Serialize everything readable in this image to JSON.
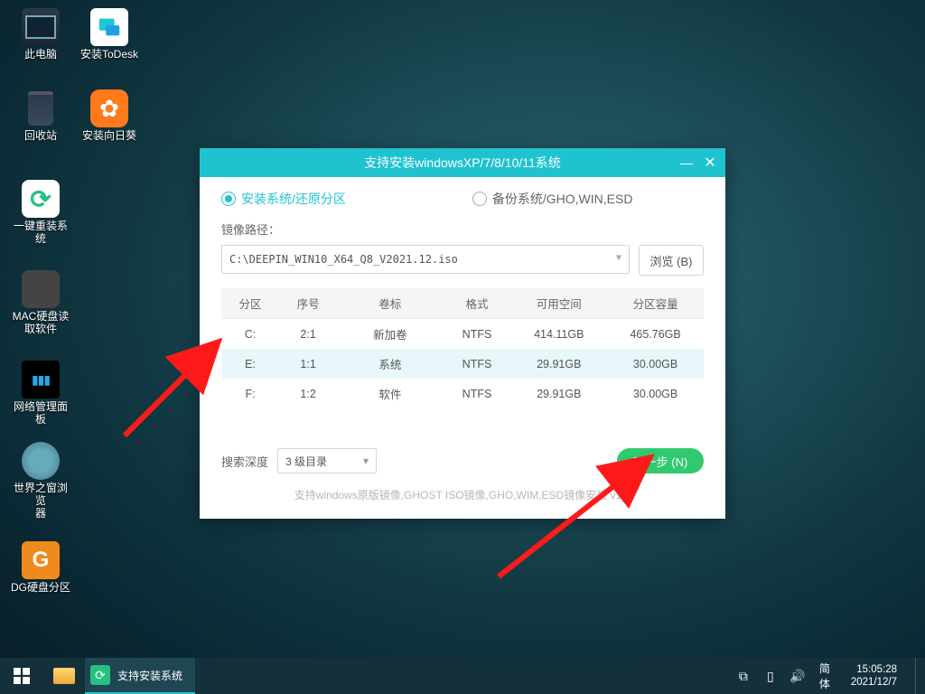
{
  "desktop_icons": [
    {
      "id": "this-pc",
      "label": "此电脑"
    },
    {
      "id": "install-todesk",
      "label": "安装ToDesk"
    },
    {
      "id": "recycle-bin",
      "label": "回收站"
    },
    {
      "id": "install-sunflower",
      "label": "安装向日葵"
    },
    {
      "id": "one-click-reinstall",
      "label": "一键重装系统"
    },
    {
      "id": "mac-disk-reader",
      "label": "MAC硬盘读\n取软件"
    },
    {
      "id": "network-panel",
      "label": "网络管理面板"
    },
    {
      "id": "world-window-browser",
      "label": "世界之窗浏览\n器"
    },
    {
      "id": "dg-partition",
      "label": "DG硬盘分区"
    }
  ],
  "installer": {
    "title": "支持安装windowsXP/7/8/10/11系统",
    "radio_install": "安装系统/还原分区",
    "radio_backup": "备份系统/GHO,WIN,ESD",
    "image_path_label": "镜像路径：",
    "image_path_value": "C:\\DEEPIN_WIN10_X64_Q8_V2021.12.iso",
    "browse_btn": "浏览 (B)",
    "table_headers": {
      "part": "分区",
      "index": "序号",
      "label": "卷标",
      "format": "格式",
      "free": "可用空间",
      "size": "分区容量"
    },
    "partitions": [
      {
        "part": "C:",
        "index": "2:1",
        "label": "新加卷",
        "format": "NTFS",
        "free": "414.11GB",
        "size": "465.76GB",
        "selected": false
      },
      {
        "part": "E:",
        "index": "1:1",
        "label": "系统",
        "format": "NTFS",
        "free": "29.91GB",
        "size": "30.00GB",
        "selected": true
      },
      {
        "part": "F:",
        "index": "1:2",
        "label": "软件",
        "format": "NTFS",
        "free": "29.91GB",
        "size": "30.00GB",
        "selected": false
      }
    ],
    "depth_label": "搜索深度",
    "depth_value": "3 级目录",
    "next_btn": "下一步 (N)",
    "footer_note": "支持windows原版镜像,GHOST ISO镜像,GHO,WIM,ESD镜像安装   v1.0"
  },
  "taskbar": {
    "running_app": "支持安装系统",
    "ime": "简体",
    "time": "15:05:28",
    "date": "2021/12/7"
  }
}
